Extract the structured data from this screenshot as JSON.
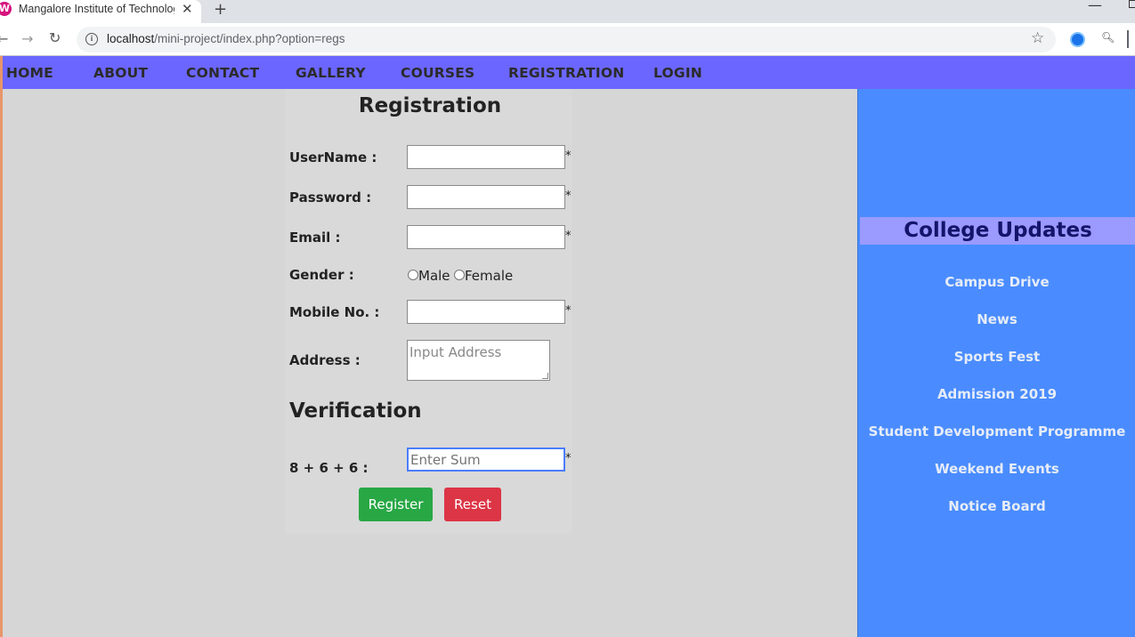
{
  "browser": {
    "tab_title": "Mangalore Institute of Technology",
    "favicon_letter": "W",
    "url_host": "localhost",
    "url_path": "/mini-project/index.php?option=regs"
  },
  "nav": {
    "items": [
      "HOME",
      "ABOUT",
      "CONTACT",
      "GALLERY",
      "COURSES",
      "REGISTRATION",
      "LOGIN"
    ]
  },
  "form": {
    "title": "Registration",
    "username_label": "UserName :",
    "password_label": "Password :",
    "email_label": "Email :",
    "gender_label": "Gender :",
    "gender_male": "Male",
    "gender_female": "Female",
    "mobile_label": "Mobile No. :",
    "address_label": "Address :",
    "address_placeholder": "Input Address",
    "required_mark": "*",
    "verification_title": "Verification",
    "sum_label": "8 + 6 + 6 :",
    "sum_placeholder": "Enter Sum",
    "register_label": "Register",
    "reset_label": "Reset",
    "register_color": "#28a745",
    "reset_color": "#dc3545"
  },
  "sidebar": {
    "title": "College Updates",
    "items": [
      "Campus Drive",
      "News",
      "Sports Fest",
      "Admission 2019",
      "Student Development Programme",
      "Weekend Events",
      "Notice Board"
    ]
  },
  "colors": {
    "navbar": "#6b66ff",
    "sidebar": "#4a8cff",
    "sidebar_title_bar": "#9a9aff",
    "page_background": "#d6d6d6"
  }
}
